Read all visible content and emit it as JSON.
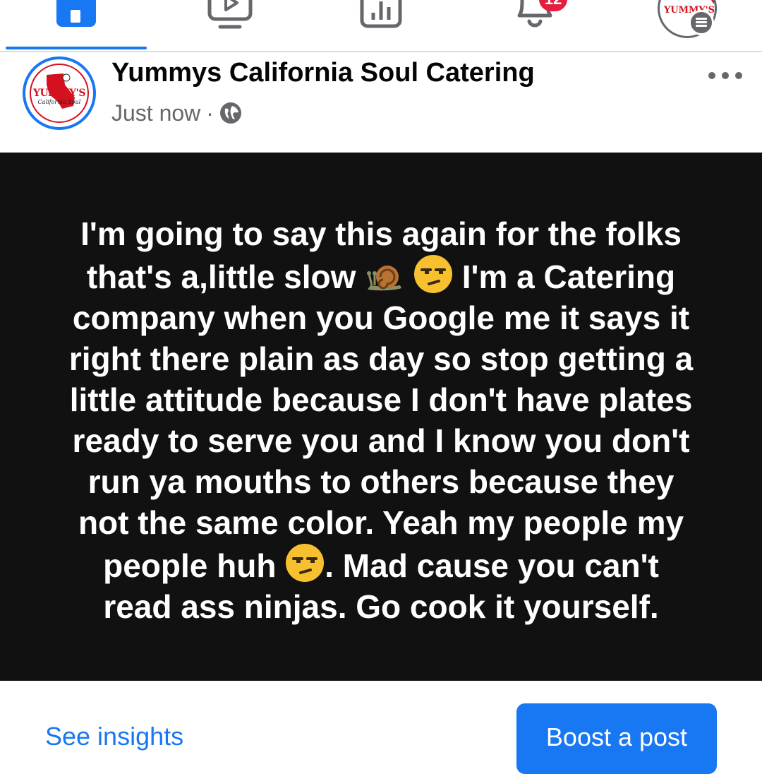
{
  "nav": {
    "tabs": [
      {
        "name": "home",
        "icon": "home-icon",
        "active": true
      },
      {
        "name": "video",
        "icon": "video-icon"
      },
      {
        "name": "insights",
        "icon": "insights-icon"
      },
      {
        "name": "notifications",
        "icon": "bell-icon"
      },
      {
        "name": "menu",
        "icon": "profile-menu-icon"
      }
    ],
    "notification_badge": "12"
  },
  "post": {
    "page_name": "Yummys California Soul Catering",
    "timestamp": "Just now",
    "separator": "·",
    "privacy_icon": "globe-icon",
    "avatar_logo_text": "YUMMY'S",
    "avatar_logo_sub": "California Soul",
    "text_lines": [
      "I'm going to say this again for the folks",
      "that's a,little slow",
      "I'm a Catering",
      "company when you Google me it says it",
      "right there plain as day so stop getting a",
      "little attitude because I don't have plates",
      "ready to serve you and I know you don't",
      "run ya mouths to others because they",
      "not the same color. Yeah my people my",
      "people huh",
      ".  Mad cause you can't",
      "read ass ninjas. Go cook it yourself."
    ],
    "emojis": [
      "snail-emoji",
      "unamused-face-emoji"
    ]
  },
  "actions": {
    "see_insights": "See insights",
    "boost_post": "Boost a post"
  },
  "colors": {
    "accent": "#1877f2",
    "post_background": "#111111",
    "badge": "#e41e3f",
    "secondary_text": "#65676b"
  }
}
